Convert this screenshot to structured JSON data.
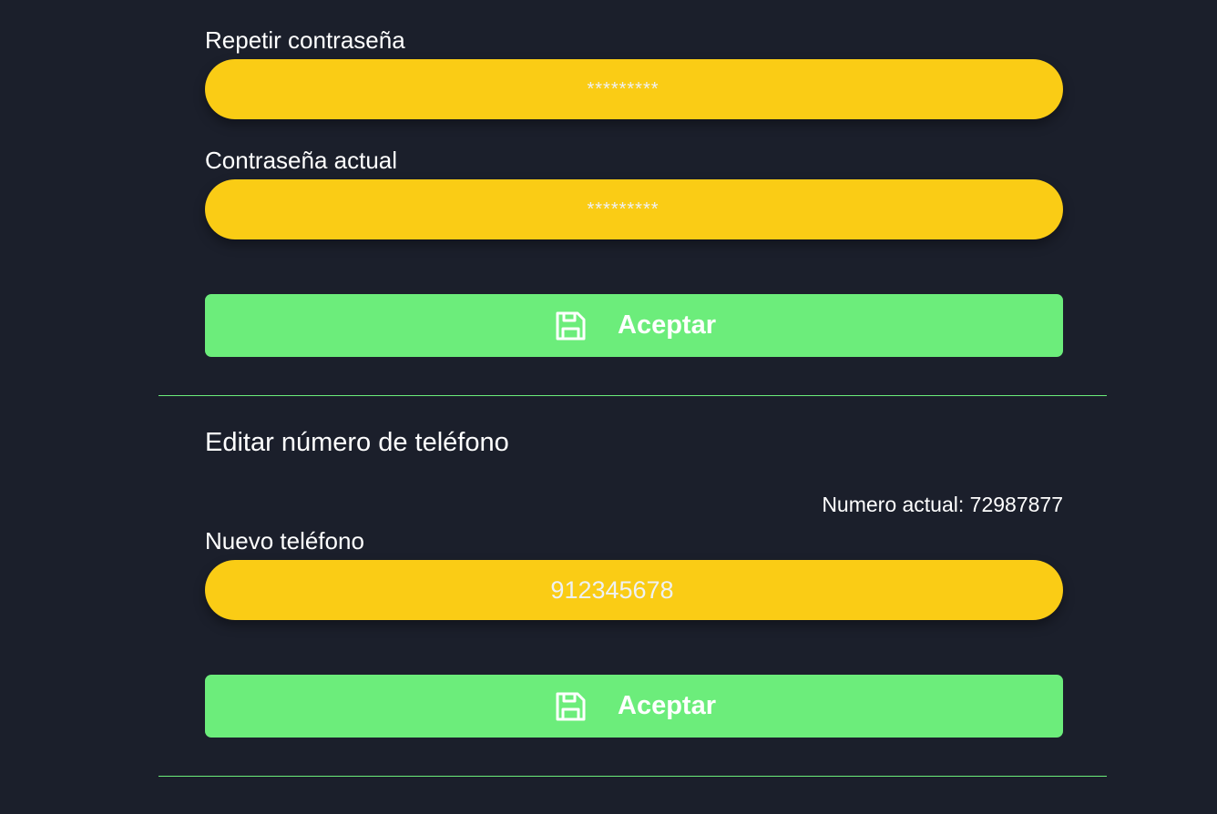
{
  "password_section": {
    "repeat_password_label": "Repetir contraseña",
    "repeat_password_placeholder": "*********",
    "current_password_label": "Contraseña actual",
    "current_password_placeholder": "*********",
    "accept_label": "Aceptar",
    "accept_icon": "save-icon"
  },
  "phone_section": {
    "title": "Editar número de teléfono",
    "current_number_text": "Numero actual: 72987877",
    "new_phone_label": "Nuevo teléfono",
    "new_phone_placeholder": "912345678",
    "accept_label": "Aceptar",
    "accept_icon": "save-icon"
  },
  "colors": {
    "background": "#1b1f2b",
    "input_fill": "#facc15",
    "button_fill": "#6ced7b",
    "divider": "#6ced7b",
    "text": "#ffffff"
  }
}
